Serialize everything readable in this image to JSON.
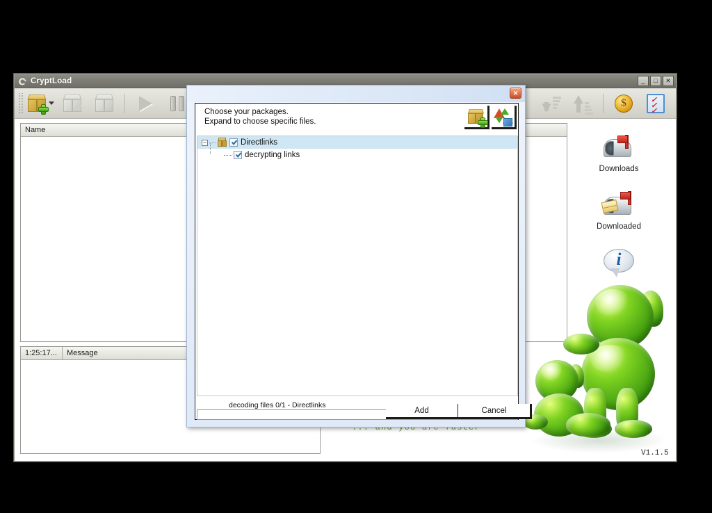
{
  "app": {
    "title": "CryptLoad",
    "version": "V1.1.5",
    "tagline": "... and you are faster",
    "window_buttons": {
      "minimize": "_",
      "maximize": "□",
      "close": "✕"
    },
    "toolbar": [
      {
        "name": "add-package",
        "icon": "package-add-icon",
        "enabled": true
      },
      {
        "name": "delete-package",
        "icon": "package-delete-icon",
        "enabled": false
      },
      {
        "name": "edit-package",
        "icon": "package-icon",
        "enabled": false
      },
      {
        "name": "start-downloads",
        "icon": "play-icon",
        "enabled": false
      },
      {
        "name": "pause-downloads",
        "icon": "pause-icon",
        "enabled": false
      },
      {
        "name": "move-down",
        "icon": "arrow-down-icon",
        "enabled": false
      },
      {
        "name": "move-up",
        "icon": "arrow-up-icon",
        "enabled": false
      },
      {
        "name": "premium-accounts",
        "icon": "coin-icon",
        "enabled": true
      },
      {
        "name": "check-links",
        "icon": "checklist-icon",
        "enabled": true
      }
    ],
    "packages_panel": {
      "columns": [
        "Name"
      ],
      "rows": []
    },
    "log_panel": {
      "columns": [
        "1:25:17...",
        "Message"
      ],
      "rows": []
    }
  },
  "desktop_icons": [
    {
      "label": "Downloads",
      "icon": "mailbox-icon"
    },
    {
      "label": "Downloaded",
      "icon": "mailbox-letter-icon"
    },
    {
      "label": "",
      "icon": "info-bubble-icon"
    }
  ],
  "dialog": {
    "title": "",
    "close_label": "✕",
    "heading_line1": "Choose your packages.",
    "heading_line2": "Expand to choose specific files.",
    "header_buttons": [
      {
        "name": "add-package-button",
        "icon": "package-add-icon"
      },
      {
        "name": "reload-button",
        "icon": "reload-container-icon"
      }
    ],
    "tree": [
      {
        "label": "Directlinks",
        "level": 0,
        "checked": true,
        "expanded": true,
        "selected": true,
        "icon": "package-icon"
      },
      {
        "label": "decrypting links",
        "level": 1,
        "checked": true,
        "expanded": null,
        "selected": false,
        "icon": ""
      }
    ],
    "status_text": "decoding files 0/1 - Directlinks",
    "progress_percent": 0,
    "buttons": {
      "add": "Add",
      "cancel": "Cancel"
    }
  },
  "colors": {
    "accent_green": "#5f9b3f",
    "title_gradient": "#7e7e76",
    "dialog_frame": "#9db4cf",
    "close_button": "#e4704a",
    "selection": "#cfe7f5"
  }
}
